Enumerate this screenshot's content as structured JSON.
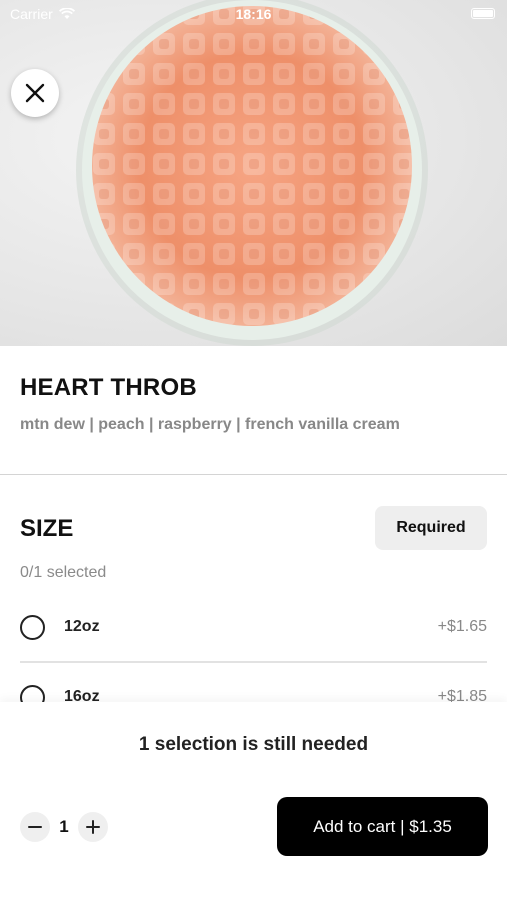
{
  "status_bar": {
    "carrier": "Carrier",
    "time": "18:16"
  },
  "product": {
    "title": "HEART THROB",
    "subtitle": "mtn dew | peach | raspberry | french vanilla cream"
  },
  "size_section": {
    "title": "SIZE",
    "required_label": "Required",
    "selected_count": "0/1 selected",
    "options": [
      {
        "name": "12oz",
        "price": "+$1.65"
      },
      {
        "name": "16oz",
        "price": "+$1.85"
      }
    ]
  },
  "footer": {
    "notice": "1 selection is still needed",
    "quantity": "1",
    "add_to_cart_label": "Add to cart | $1.35"
  },
  "colors": {
    "drink": "#f0906a",
    "button": "#000000",
    "badge_bg": "#eeeeee"
  },
  "icons": [
    "wifi-icon",
    "battery-icon",
    "close-icon",
    "minus-icon",
    "plus-icon"
  ]
}
